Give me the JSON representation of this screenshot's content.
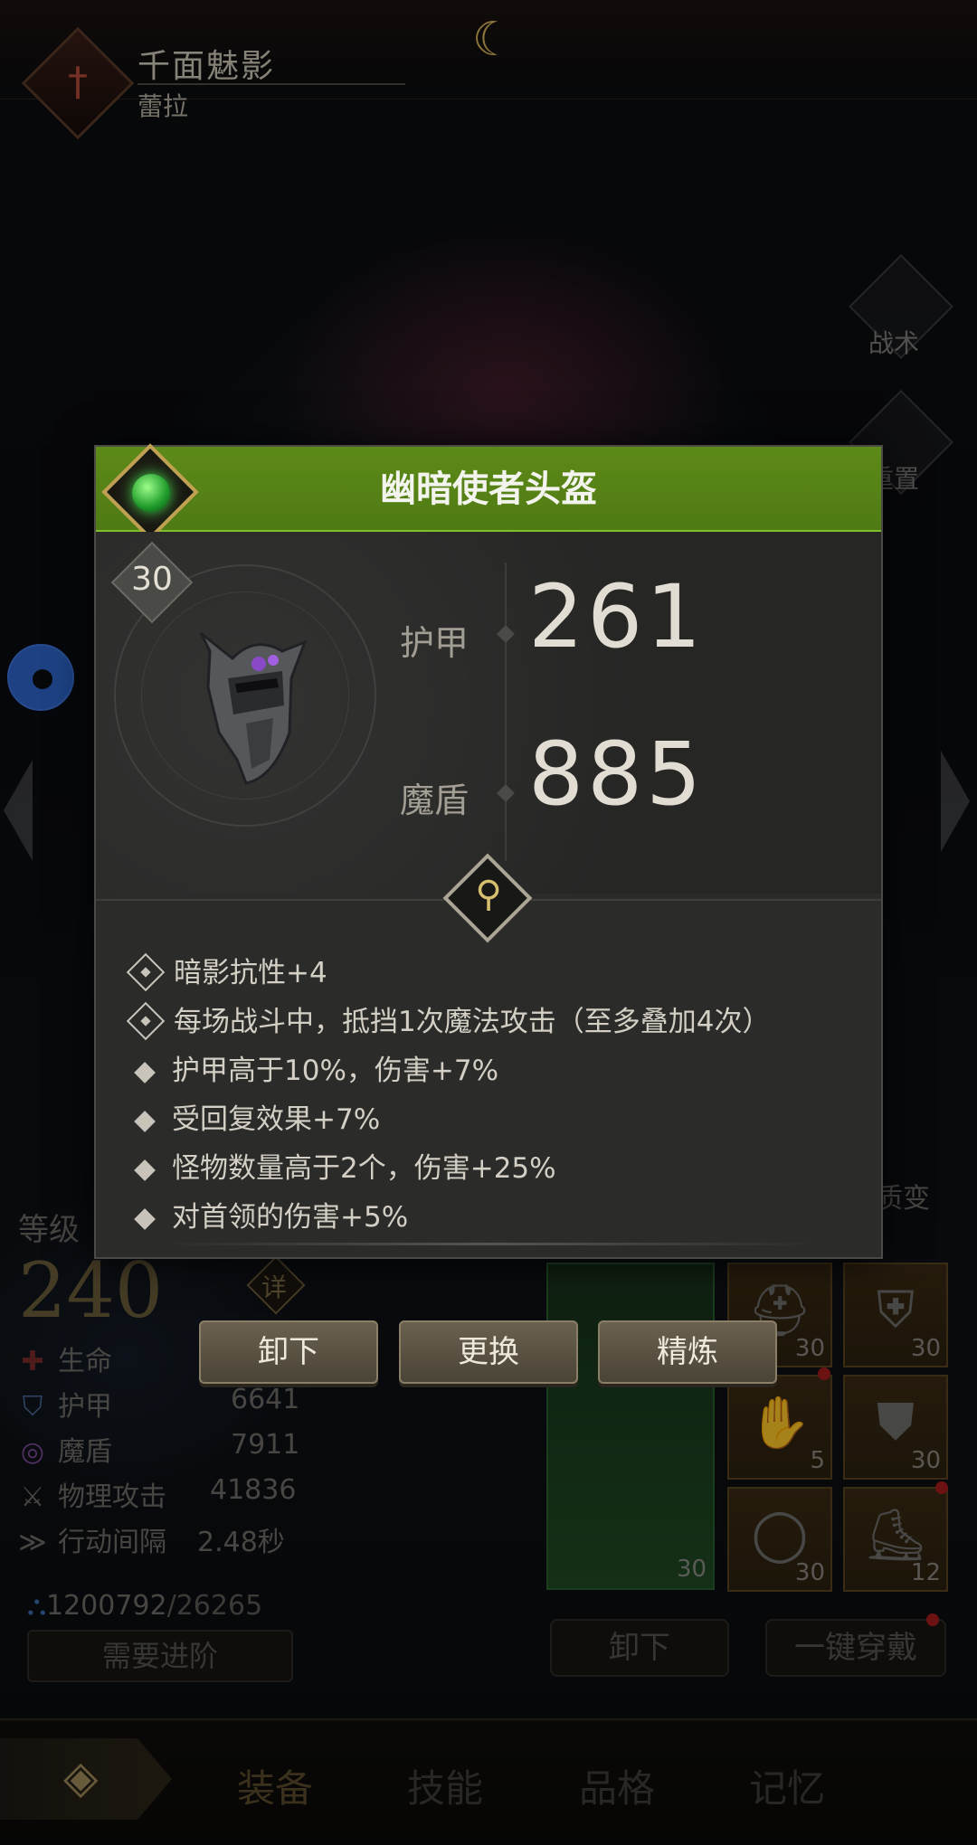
{
  "header": {
    "hero_name": "千面魅影",
    "hero_subname": "蕾拉"
  },
  "side_menu": {
    "tactics_label": "战术",
    "reset_label": "重置",
    "transmute_label": "质变"
  },
  "item_dialog": {
    "title": "幽暗使者头盔",
    "rarity_color": "#4f7a14",
    "level": "30",
    "stats": [
      {
        "name": "护甲",
        "value": "261"
      },
      {
        "name": "魔盾",
        "value": "885"
      }
    ],
    "attributes": [
      {
        "marker": "lock",
        "text": "暗影抗性+4"
      },
      {
        "marker": "lock",
        "text": "每场战斗中，抵挡1次魔法攻击（至多叠加4次）"
      },
      {
        "marker": "bullet",
        "text": "护甲高于10%，伤害+7%"
      },
      {
        "marker": "bullet",
        "text": "受回复效果+7%"
      },
      {
        "marker": "bullet",
        "text": "怪物数量高于2个，伤害+25%"
      },
      {
        "marker": "bullet",
        "text": "对首领的伤害+5%"
      }
    ],
    "actions": {
      "unequip": "卸下",
      "replace": "更换",
      "refine": "精炼"
    }
  },
  "character": {
    "level_label": "等级",
    "level_value": "240",
    "detail_label": "详",
    "stats": [
      {
        "icon": "health-icon",
        "label": "生命",
        "value": ""
      },
      {
        "icon": "armor-icon",
        "label": "护甲",
        "value": "6641"
      },
      {
        "icon": "magic-shield-icon",
        "label": "魔盾",
        "value": "7911"
      },
      {
        "icon": "physical-attack-icon",
        "label": "物理攻击",
        "value": "41836"
      },
      {
        "icon": "action-interval-icon",
        "label": "行动间隔",
        "value": "2.48秒"
      }
    ],
    "currency": "1200792",
    "currency_cap": "/26265",
    "advance_label": "需要进阶"
  },
  "equipment": {
    "weapon_level": "30",
    "slots": [
      {
        "icon": "helmet-icon",
        "level": "30"
      },
      {
        "icon": "chest-armor-icon",
        "level": "30"
      },
      {
        "icon": "gloves-icon",
        "level": "5"
      },
      {
        "icon": "pants-icon",
        "level": "30"
      },
      {
        "icon": "ring-icon",
        "level": "30"
      },
      {
        "icon": "boots-icon",
        "level": "12"
      }
    ],
    "unequip_label": "卸下",
    "equip_all_label": "一键穿戴"
  },
  "nav": {
    "tabs": [
      "装备",
      "技能",
      "品格",
      "记忆"
    ]
  }
}
